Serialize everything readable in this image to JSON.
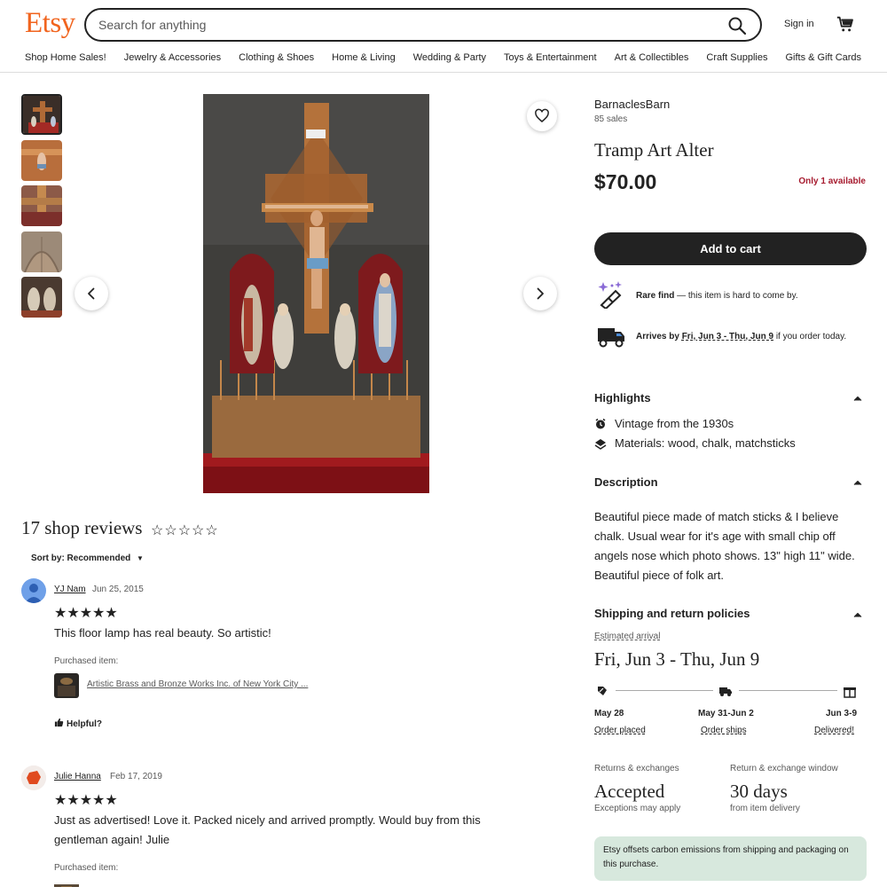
{
  "header": {
    "logo": "Etsy",
    "search_placeholder": "Search for anything",
    "sign_in": "Sign in",
    "nav": [
      "Shop Home Sales!",
      "Jewelry & Accessories",
      "Clothing & Shoes",
      "Home & Living",
      "Wedding & Party",
      "Toys & Entertainment",
      "Art & Collectibles",
      "Craft Supplies",
      "Gifts & Gift Cards"
    ]
  },
  "listing": {
    "shop_name": "BarnaclesBarn",
    "sales": "85 sales",
    "title": "Tramp Art Alter",
    "price": "$70.00",
    "availability": "Only 1 available",
    "add_to_cart": "Add to cart",
    "rare_find_bold": "Rare find",
    "rare_find_rest": " — this item is hard to come by.",
    "arrives_prefix": "Arrives by ",
    "arrives_dates": "Fri, Jun 3 - Thu, Jun 9",
    "arrives_suffix": " if you order today."
  },
  "highlights": {
    "heading": "Highlights",
    "items": [
      "Vintage from the 1930s",
      "Materials: wood, chalk, matchsticks"
    ]
  },
  "description": {
    "heading": "Description",
    "text": "Beautiful piece made of match sticks & I believe chalk. Usual wear for it's age with small chip off angels nose which photo shows. 13\" high 11\" wide. Beautiful piece of folk art."
  },
  "shipping": {
    "heading": "Shipping and return policies",
    "estimated_label": "Estimated arrival",
    "estimated_dates": "Fri, Jun 3 - Thu, Jun 9",
    "timeline": [
      {
        "date": "May 28",
        "label": "Order placed"
      },
      {
        "date": "May 31-Jun 2",
        "label": "Order ships"
      },
      {
        "date": "Jun 3-9",
        "label": "Delivered!"
      }
    ],
    "returns_label": "Returns & exchanges",
    "returns_value": "Accepted",
    "returns_sub": "Exceptions may apply",
    "window_label": "Return & exchange window",
    "window_value": "30 days",
    "window_sub": "from item delivery",
    "carbon": "Etsy offsets carbon emissions from shipping and packaging on this purchase."
  },
  "reviews": {
    "title": "17 shop reviews",
    "rating_stars": "☆☆☆☆☆",
    "sort_label": "Sort by: Recommended",
    "items": [
      {
        "name": "YJ Nam",
        "date": "Jun 25, 2015",
        "stars": "★★★★★",
        "text": "This floor lamp has real beauty. So artistic!",
        "purchased_label": "Purchased item:",
        "item": "Artistic Brass and Bronze Works Inc. of New York City ..."
      },
      {
        "name": "Julie Hanna",
        "date": "Feb 17, 2019",
        "stars": "★★★★★",
        "text": "Just as advertised! Love it. Packed nicely and arrived promptly. Would buy from this gentleman again! Julie",
        "purchased_label": "Purchased item:"
      }
    ],
    "helpful": "Helpful?"
  },
  "colors": {
    "brand": "#f1641e",
    "availability": "#a61a2e",
    "carbon_bg": "#d7e8dd"
  }
}
